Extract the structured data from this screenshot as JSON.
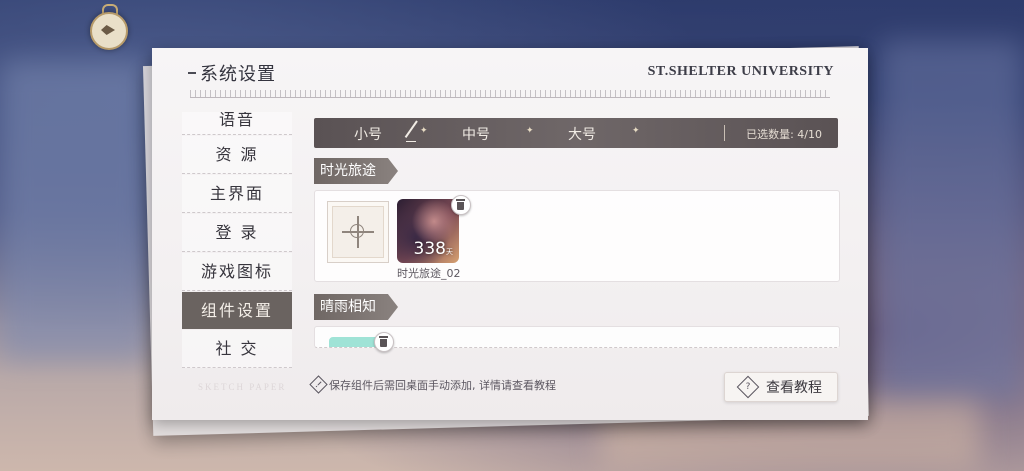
{
  "panel": {
    "title": "系统设置",
    "brand": "ST.SHELTER UNIVERSITY"
  },
  "sidebar": {
    "items": [
      {
        "label": "语音",
        "state": "cut"
      },
      {
        "label": "资 源"
      },
      {
        "label": "主界面"
      },
      {
        "label": "登 录"
      },
      {
        "label": "游戏图标"
      },
      {
        "label": "组件设置",
        "state": "active"
      },
      {
        "label": "社 交"
      }
    ],
    "footer_text": "SKETCH PAPER"
  },
  "size_tabs": {
    "options": [
      "小号",
      "中号",
      "大号"
    ],
    "selected": "小号",
    "selected_count": "已选数量: 4/10"
  },
  "sections": [
    {
      "title": "时光旅途",
      "widgets": [
        {
          "value": "338",
          "unit": "天",
          "label": "时光旅途_02"
        }
      ]
    },
    {
      "title": "晴雨相知",
      "widgets": []
    }
  ],
  "footer": {
    "notice": "保存组件后需回桌面手动添加, 详情请查看教程",
    "tutorial_button": "查看教程"
  },
  "icons": {
    "emblem": "crest-emblem-icon",
    "pen": "pen-icon",
    "add": "add-slot-icon",
    "trash": "trash-icon",
    "warning": "warning-icon",
    "help": "question-icon"
  },
  "colors": {
    "active_bg": "#6a6360",
    "tab_bar_bg": "#6f6768",
    "panel_bg": "#f7f5f6"
  }
}
